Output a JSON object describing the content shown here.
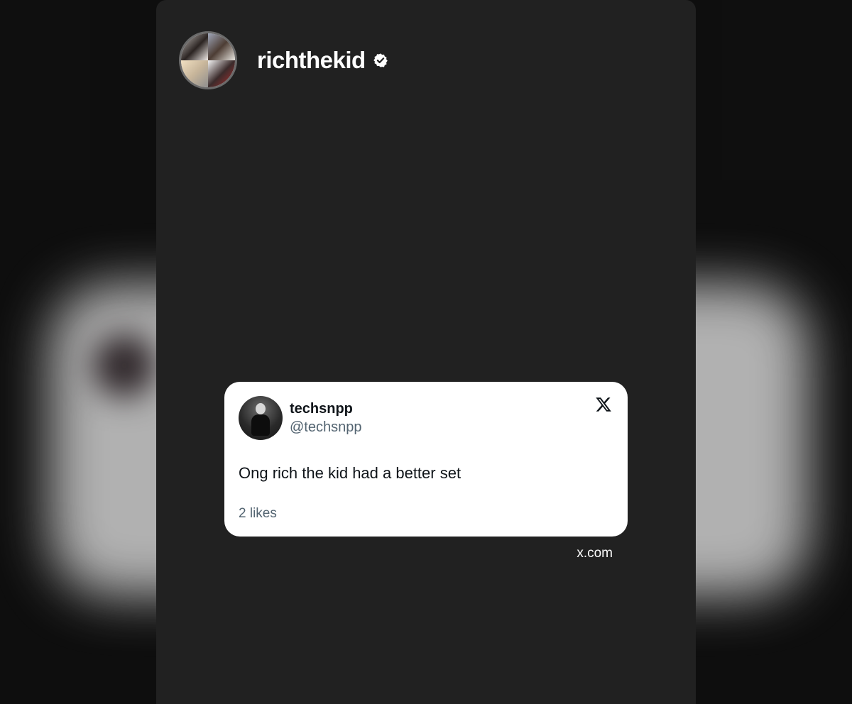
{
  "story": {
    "username": "richthekid",
    "verified": true
  },
  "tweet": {
    "display_name": "techsnpp",
    "handle": "@techsnpp",
    "text": "Ong rich the kid had a better set",
    "likes": "2 likes",
    "platform_icon": "x-logo-icon"
  },
  "source": {
    "domain": "x.com"
  },
  "colors": {
    "story_background": "#212121",
    "card_background": "#ffffff",
    "secondary_text": "#536471"
  }
}
